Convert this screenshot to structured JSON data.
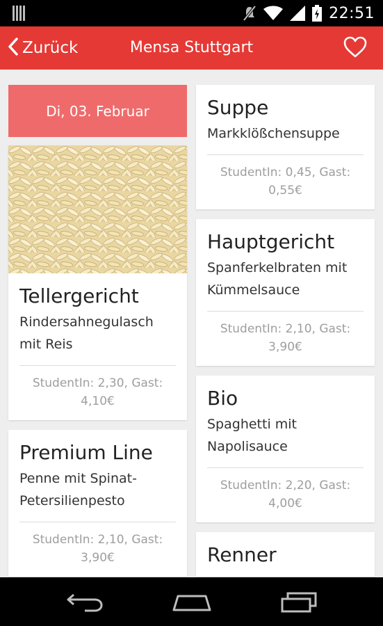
{
  "status_bar": {
    "time": "22:51",
    "icons": [
      "notification-bars-icon",
      "mute-icon",
      "wifi-icon",
      "signal-icon",
      "battery-icon"
    ]
  },
  "app_bar": {
    "back_label": "Zurück",
    "title": "Mensa Stuttgart",
    "color": "#e53935"
  },
  "date_banner": {
    "label": "Di, 03. Februar",
    "color": "#ef6b6b"
  },
  "meals_left": [
    {
      "category": "Tellergericht",
      "dish": "Rindersahnegulasch mit Reis",
      "price": "StudentIn: 2,30, Gast: 4,10€",
      "image": "rice-photo"
    },
    {
      "category": "Premium Line",
      "dish": "Penne mit Spinat-Petersilienpesto",
      "price": "StudentIn: 2,10, Gast: 3,90€"
    }
  ],
  "meals_right": [
    {
      "category": "Suppe",
      "dish": "Markklößchensuppe",
      "price": "StudentIn: 0,45, Gast: 0,55€"
    },
    {
      "category": "Hauptgericht",
      "dish": "Spanferkelbraten mit Kümmelsauce",
      "price": "StudentIn: 2,10, Gast: 3,90€"
    },
    {
      "category": "Bio",
      "dish": "Spaghetti mit Napolisauce",
      "price": "StudentIn: 2,20, Gast: 4,00€"
    },
    {
      "category": "Renner"
    }
  ],
  "nav_bar": {
    "buttons": [
      "back-icon",
      "home-icon",
      "recent-apps-icon"
    ]
  }
}
